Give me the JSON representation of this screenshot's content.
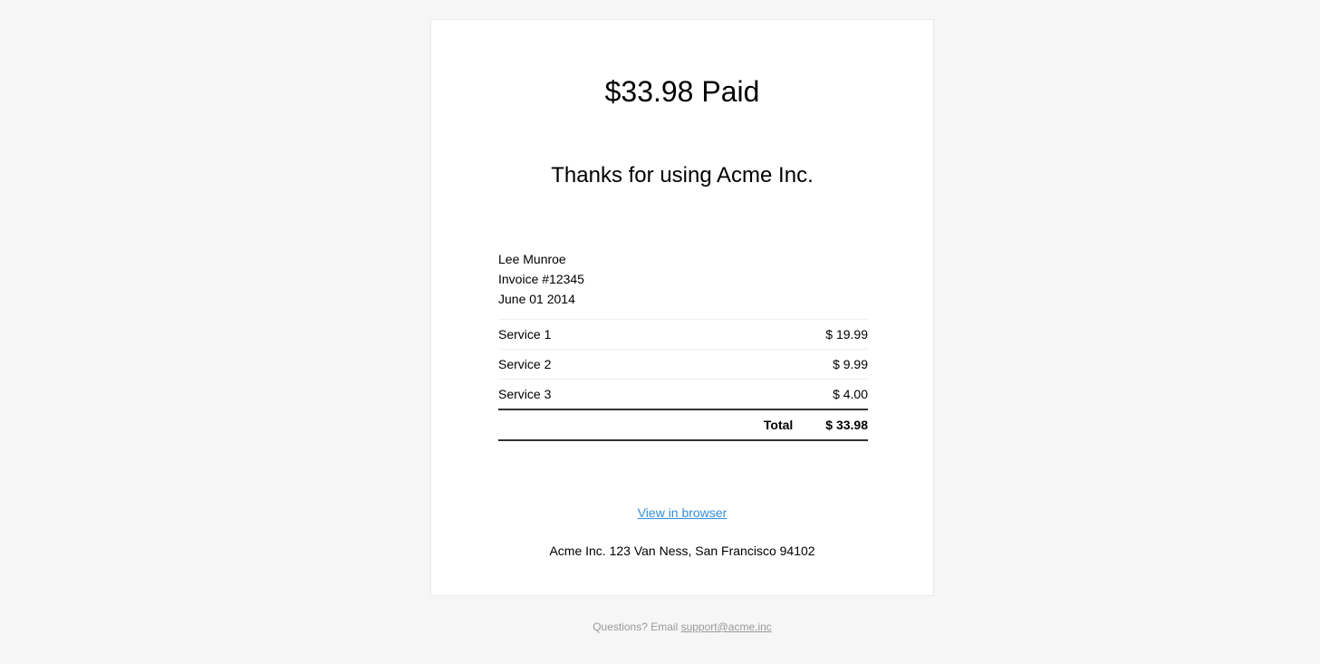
{
  "receipt": {
    "headline": "$33.98 Paid",
    "thanks": "Thanks for using Acme Inc.",
    "customer_name": "Lee Munroe",
    "invoice_number": "Invoice #12345",
    "date": "June 01 2014",
    "items": [
      {
        "name": "Service 1",
        "price": "$ 19.99"
      },
      {
        "name": "Service 2",
        "price": "$ 9.99"
      },
      {
        "name": "Service 3",
        "price": "$ 4.00"
      }
    ],
    "total_label": "Total",
    "total_value": "$ 33.98",
    "view_in_browser": "View in browser",
    "address": "Acme Inc. 123 Van Ness, San Francisco 94102"
  },
  "footer": {
    "prefix": "Questions? Email ",
    "email": "support@acme.inc"
  },
  "colors": {
    "background": "#f6f6f6",
    "link": "#348eda",
    "footer_text": "#999999"
  }
}
